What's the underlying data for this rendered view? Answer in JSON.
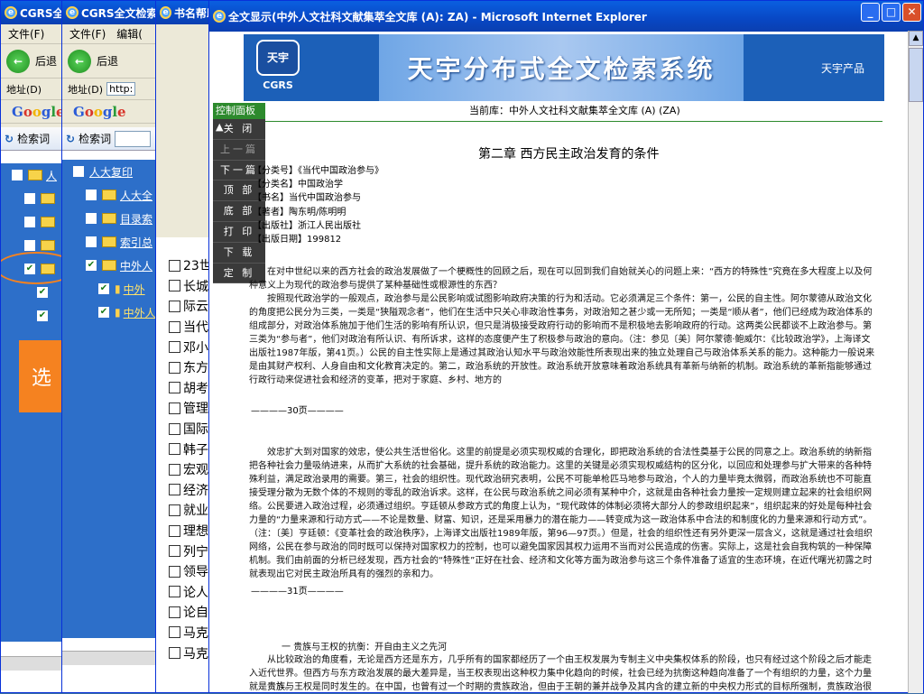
{
  "windows": [
    {
      "title": "CGRS全"
    },
    {
      "title": "CGRS全文检索"
    },
    {
      "title": "书名帮助"
    }
  ],
  "back_windows": {
    "menu_file_1": "文件(F)",
    "menu_file_2": "文件(F)",
    "menu_edit": "编辑(",
    "back_label": "后退",
    "back_label_2": "后退",
    "addr_label": "地址(D)",
    "addr_label_2": "地址(D)",
    "addr_value": "http:",
    "google_g": "G",
    "google_o1": "o",
    "google_o2": "o",
    "google_g2": "g",
    "google_l": "l",
    "google_e": "e",
    "search_label_1": "检索词",
    "search_label_2": "检索词"
  },
  "tree_left": [
    {
      "label": "人",
      "checked": false
    },
    {
      "label": "",
      "checked": false
    },
    {
      "label": "",
      "checked": false
    },
    {
      "label": "",
      "checked": false
    },
    {
      "label": "",
      "checked": true
    }
  ],
  "tree_right": [
    {
      "label": "人大复印"
    },
    {
      "label": "人大全"
    },
    {
      "label": "目录索"
    },
    {
      "label": "索引总"
    },
    {
      "label": "中外人"
    },
    {
      "label": "中外"
    },
    {
      "label": "中外人"
    }
  ],
  "orange_label": "选",
  "list_items": [
    "23世",
    "长城",
    "际云",
    "当代",
    "邓小",
    "东方",
    "胡考",
    "管理",
    "国际",
    "韩子",
    "宏观",
    "经济",
    "就业",
    "理想",
    "列宁",
    "领导",
    "论人",
    "论自",
    "马克",
    "马克"
  ],
  "main_window": {
    "title": "全文显示(中外人文社科文献集萃全文库 (A): ZA) - Microsoft Internet Explorer",
    "system_title": "天宇分布式全文检索系统",
    "logo_text": "天宇",
    "logo_sub": "CGRS",
    "product_label": "天宇产品",
    "current_db": "当前库：中外人文社科文献集萃全文库 (A) (ZA)",
    "control_panel": "控制面板",
    "buttons": [
      "关 闭",
      "上一篇",
      "下一篇",
      "顶 部",
      "底 部",
      "打 印",
      "下 载",
      "定 制"
    ],
    "chapter_title": "第二章  西方民主政治发育的条件",
    "meta": [
      "【分类号】《当代中国政治参与》",
      "【分类名】中国政治学",
      "【书名】当代中国政治参与",
      "【著者】陶东明/陈明明",
      "【出版社】浙江人民出版社",
      "【出版日期】199812"
    ],
    "para1": "在对中世纪以来的西方社会的政治发展做了一个梗概性的回顾之后，现在可以回到我们自始就关心的问题上来：“西方的特殊性”究竟在多大程度上以及何种意义上为现代的政治参与提供了某种基础性或根源性的东西？",
    "para2": "按照现代政治学的一般观点，政治参与是公民影响或试图影响政府决策的行为和活动。它必须满足三个条件：第一，公民的自主性。阿尔蒙德从政治文化的角度把公民分为三类，一类是“狭隘观念者”，他们在生活中只关心非政治性事务，对政治知之甚少或一无所知；一类是“顺从者”，他们已经成为政治体系的组成部分，对政治体系施加于他们生活的影响有所认识，但只是消极接受政府行动的影响而不是积极地去影响政府的行动。这两类公民都谈不上政治参与。第三类为“参与者”，他们对政治有所认识、有所诉求，这样的态度便产生了积极参与政治的意向。（注：参见〔美〕阿尔蒙德·鲍威尔：《比较政治学》，上海译文出版社1987年版，第41页。）公民的自主性实际上是通过其政治认知水平与政治效能性所表现出来的独立处理自己与政治体系关系的能力。这种能力一般说来是由其财产权利、人身自由和文化教育决定的。第二，政治系统的开放性。政治系统开放意味着政治系统具有革新与纳新的机制。政治系统的革新指能够通过行政行动来促进社会和经济的变革，把对于家庭、乡村、地方的",
    "page30": "————30页————",
    "para3": "效忠扩大到对国家的效忠，使公共生活世俗化。这里的前提是必须实现权威的合理化，即把政治系统的合法性奠基于公民的同意之上。政治系统的纳新指把各种社会力量吸纳进来，从而扩大系统的社会基础，提升系统的政治能力。这里的关键是必须实现权威结构的区分化，以回应和处理参与扩大带来的各种特殊利益，满足政治录用的需要。第三，社会的组织性。现代政治研究表明，公民不可能单枪匹马地参与政治，个人的力量毕竟太微弱，而政治系统也不可能直接受理分散为无数个体的不规则的零乱的政治诉求。这样，在公民与政治系统之间必须有某种中介，这就是由各种社会力量按一定规则建立起来的社会组织网络。公民要进入政治过程，必须通过组织。亨廷顿从参政方式的角度上认为，“现代政体的体制必须将大部分人的参政组织起来”，组织起来的好处是每种社会力量的“力量来源和行动方式——不论是数量、财富、知识，还是采用暴力的潜在能力——转变成为这一政治体系中合法的和制度化的力量来源和行动方式”。（注：〔美〕亨廷顿：《变革社会的政治秩序》，上海译文出版社1989年版，第96—97页。）但是，社会的组织性还有另外更深一层含义，这就是通过社会组织网络，公民在参与政治的同时既可以保持对国家权力的控制，也可以避免国家因其权力运用不当而对公民造成的伤害。实际上，这是社会自我构筑的一种保障机制。我们由前面的分析已经发现，西方社会的“特殊性”正好在社会、经济和文化等方面为政治参与这三个条件准备了适宜的生态环境，在近代曙光初露之时就表现出它对民主政治所具有的强烈的亲和力。",
    "page31": "————31页————",
    "subhead": "一  贵族与王权的抗衡：开自由主义之先河",
    "para4": "从比较政治的角度看，无论是西方还是东方，几乎所有的国家都经历了一个由王权发展为专制主义中央集权体系的阶段，也只有经过这个阶段之后才能走入近代世界。但西方与东方政治发展的最大差异是，当王权表现出这种权力集中化趋向的时候，社会已经为抗衡这种趋向准备了一个有组织的力量，这个力量就是贵族。",
    "para5": "贵族与王权是同时发生的。在中国，也曾有过一个时期的贵族政治，但由于王朝的兼并战争及其内含的建立新的中央权力形式的目标所强制，贵族政治很快就异化"
  }
}
